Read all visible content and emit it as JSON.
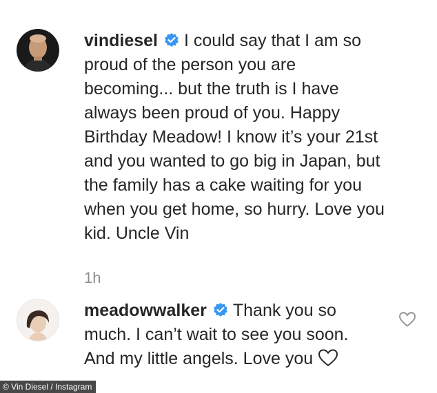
{
  "comments": [
    {
      "username": "vindiesel",
      "verified": true,
      "text_lines": [
        "I could say that I am so",
        "proud of the person you are",
        "becoming... but the truth is I have",
        "always been proud of you. Happy",
        "Birthday Meadow! I know it’s your 21st",
        "and you wanted to go big in Japan, but",
        "the family has a cake waiting for you",
        "when you get home, so hurry. Love you",
        "kid. Uncle Vin"
      ],
      "time": "1h",
      "avatar_icon": "profile-photo-man"
    },
    {
      "username": "meadowwalker",
      "verified": true,
      "text_lines": [
        "Thank you so",
        "much. I can’t wait to see you soon.",
        "And my little angels. Love you"
      ],
      "inline_icon": "heart-outline-icon",
      "like_icon": "heart-outline-icon",
      "avatar_icon": "profile-photo-woman"
    }
  ],
  "credit": "© Vin Diesel / Instagram",
  "colors": {
    "text": "#262626",
    "muted": "#8e8e8e",
    "verified_blue": "#3897f0"
  }
}
